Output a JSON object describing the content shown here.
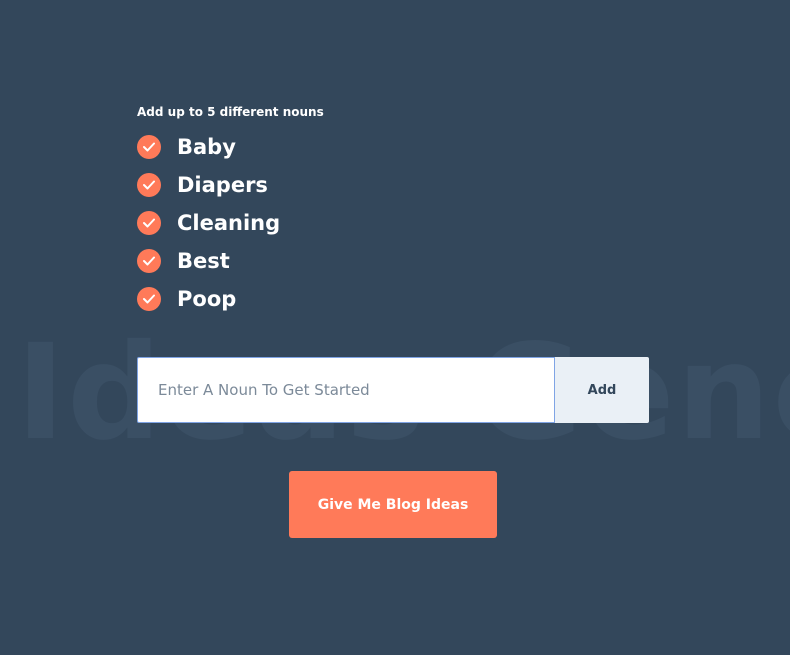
{
  "background_watermark": "Ideas Gene",
  "hint": "Add up to 5 different nouns",
  "nouns": [
    {
      "label": "Baby",
      "icon": "check-icon"
    },
    {
      "label": "Diapers",
      "icon": "check-icon"
    },
    {
      "label": "Cleaning",
      "icon": "check-icon"
    },
    {
      "label": "Best",
      "icon": "check-icon"
    },
    {
      "label": "Poop",
      "icon": "check-icon"
    }
  ],
  "input": {
    "placeholder": "Enter A Noun To Get Started",
    "value": ""
  },
  "add_button": {
    "label": "Add"
  },
  "cta_button": {
    "label": "Give Me Blog Ideas"
  },
  "colors": {
    "background": "#33475b",
    "accent": "#ff7a59",
    "input_border": "#7fa4e5",
    "add_button_bg": "#eaf0f6"
  }
}
